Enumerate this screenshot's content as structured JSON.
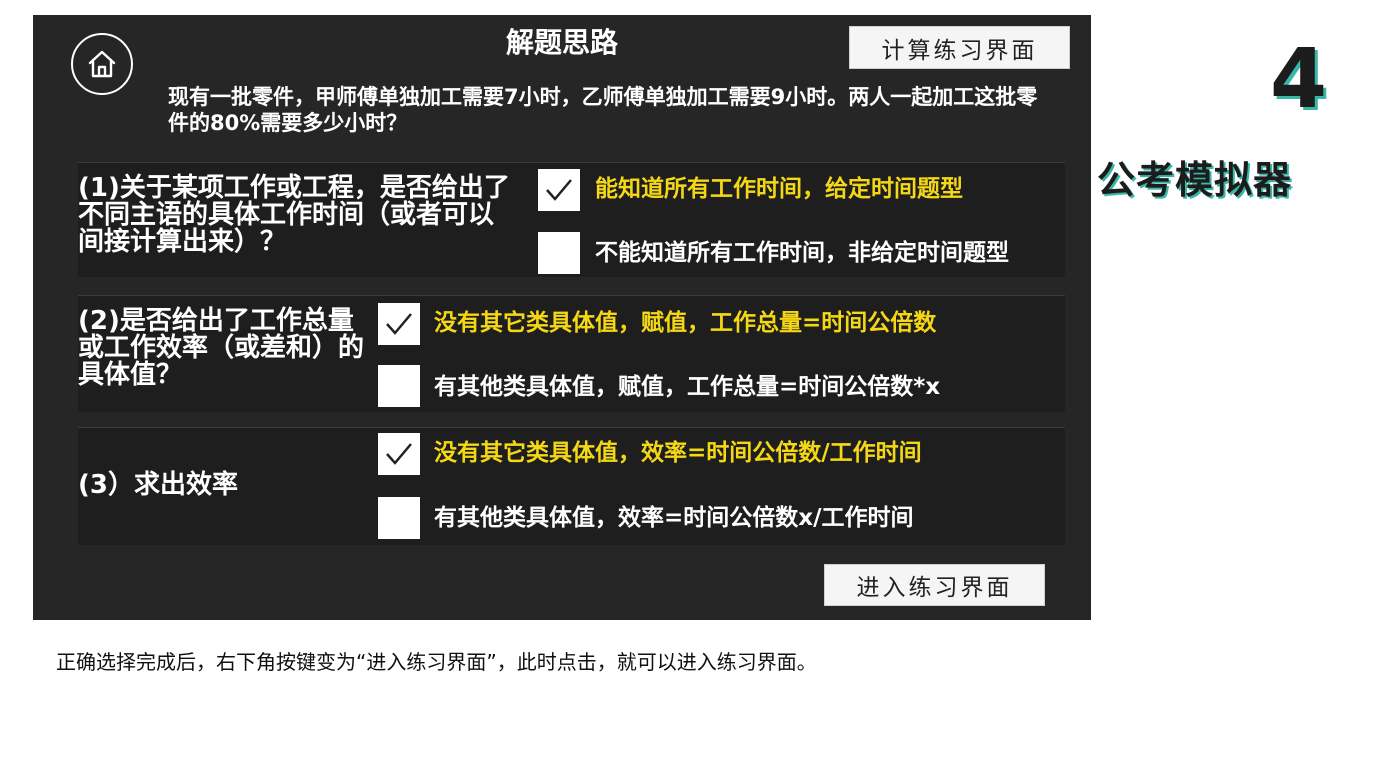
{
  "panel": {
    "title": "解题思路",
    "calc_button": "计算练习界面",
    "enter_button": "进入练习界面",
    "question": "现有一批零件，甲师傅单独加工需要7小时，乙师傅单独加工需要9小时。两人一起加工这批零件的80%需要多少小时？"
  },
  "sections": [
    {
      "label": "(1)关于某项工作或工程，是否给出了不同主语的具体工作时间（或者可以间接计算出来）？",
      "options": [
        {
          "text": "能知道所有工作时间，给定时间题型",
          "checked": true
        },
        {
          "text": "不能知道所有工作时间，非给定时间题型",
          "checked": false
        }
      ]
    },
    {
      "label": "(2)是否给出了工作总量或工作效率（或差和）的具体值？",
      "options": [
        {
          "text": "没有其它类具体值，赋值，工作总量=时间公倍数",
          "checked": true
        },
        {
          "text": "有其他类具体值，赋值，工作总量=时间公倍数*x",
          "checked": false
        }
      ]
    },
    {
      "label": "(3）求出效率",
      "options": [
        {
          "text": "没有其它类具体值，效率=时间公倍数/工作时间",
          "checked": true
        },
        {
          "text": "有其他类具体值，效率=时间公倍数x/工作时间",
          "checked": false
        }
      ]
    }
  ],
  "side": {
    "number": "4",
    "brand": "公考模拟器"
  },
  "caption": "正确选择完成后，右下角按键变为“进入练习界面”，此时点击，就可以进入练习界面。",
  "colors": {
    "panel_bg": "#262626",
    "selected_option": "#f5d815",
    "accent": "#37b7a8"
  },
  "icons": {
    "home": "home-icon",
    "check": "checkmark-icon"
  }
}
